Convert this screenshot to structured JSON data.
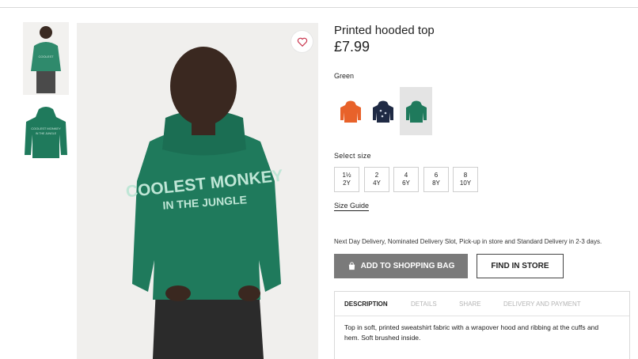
{
  "product": {
    "name": "Printed hooded top",
    "price": "£7.99",
    "color_label": "Green",
    "hoodie_print_line1": "COOLEST MONKEY",
    "hoodie_print_line2": "IN THE JUNGLE"
  },
  "swatches": [
    {
      "name": "orange",
      "color": "#e8622a"
    },
    {
      "name": "navy",
      "color": "#1f2a44"
    },
    {
      "name": "green",
      "color": "#1f7a5c",
      "selected": true
    }
  ],
  "sizes": {
    "label": "Select size",
    "options": [
      {
        "top": "1½",
        "bottom": "2Y"
      },
      {
        "top": "2",
        "bottom": "4Y"
      },
      {
        "top": "4",
        "bottom": "6Y"
      },
      {
        "top": "6",
        "bottom": "8Y"
      },
      {
        "top": "8",
        "bottom": "10Y"
      }
    ],
    "guide_label": "Size Guide"
  },
  "delivery_text": "Next Day Delivery, Nominated Delivery Slot, Pick-up in store and Standard Delivery in 2-3 days.",
  "buttons": {
    "add_to_bag": "ADD TO SHOPPING BAG",
    "find_in_store": "FIND IN STORE"
  },
  "tabs": [
    "DESCRIPTION",
    "DETAILS",
    "SHARE",
    "DELIVERY AND PAYMENT"
  ],
  "description": "Top in soft, printed sweatshirt fabric with a wrapover hood and ribbing at the cuffs and hem. Soft brushed inside.",
  "colors": {
    "hoodie_green": "#1f7a5c",
    "button_gray": "#7a7a7a",
    "heart_red": "#c8314a"
  },
  "icons": [
    "heart-icon",
    "shopping-bag-icon"
  ]
}
